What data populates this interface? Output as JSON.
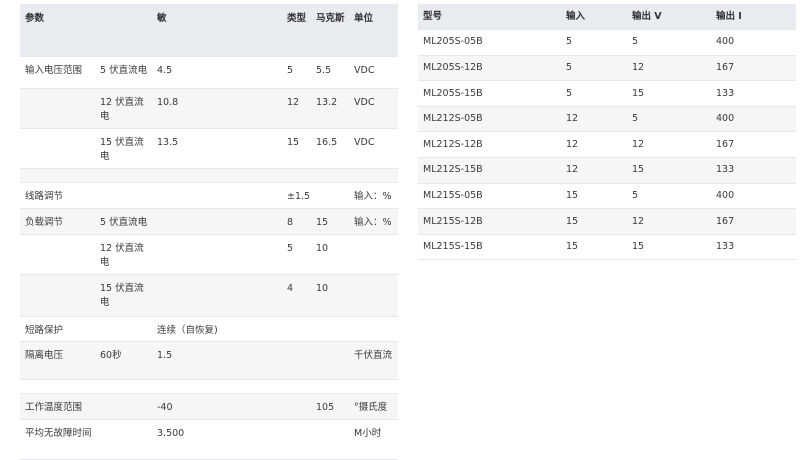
{
  "spec_table": {
    "headers": [
      "参数",
      "",
      "敏",
      "类型",
      "马克斯",
      "单位"
    ],
    "rows": [
      [
        "输入电压范围",
        "5 伏直流电",
        "4.5",
        "5",
        "5.5",
        "VDC"
      ],
      [
        "",
        "12 伏直流电",
        "10.8",
        "12",
        "13.2",
        "VDC"
      ],
      [
        "",
        "15 伏直流电",
        "13.5",
        "15",
        "16.5",
        "VDC"
      ],
      [
        "",
        "",
        "",
        "",
        "",
        ""
      ],
      [
        "线路调节",
        "",
        "",
        "±1.5",
        "",
        "输入：%"
      ],
      [
        "负载调节",
        "5 伏直流电",
        "",
        "8",
        "15",
        "输入：%"
      ],
      [
        "",
        "12 伏直流电",
        "",
        "5",
        "10",
        ""
      ],
      [
        "",
        "15 伏直流电",
        "",
        "4",
        "10",
        ""
      ],
      [
        "短路保护",
        "",
        "连续（自恢复)",
        "",
        "",
        ""
      ],
      [
        "隔离电压",
        "60秒",
        "1.5",
        "",
        "",
        "千伏直流"
      ],
      [
        "",
        "",
        "",
        "",
        "",
        ""
      ],
      [
        "工作温度范围",
        "",
        "-40",
        "",
        "105",
        "°摄氏度"
      ],
      [
        "平均无故障时间",
        "",
        "3.500",
        "",
        "",
        "M小时"
      ]
    ]
  },
  "model_table": {
    "headers": [
      "型号",
      "输入",
      "输出 V",
      "输出 I"
    ],
    "rows": [
      [
        "ML205S-05B",
        "5",
        "5",
        "400"
      ],
      [
        "ML205S-12B",
        "5",
        "12",
        "167"
      ],
      [
        "ML205S-15B",
        "5",
        "15",
        "133"
      ],
      [
        "ML212S-05B",
        "12",
        "5",
        "400"
      ],
      [
        "ML212S-12B",
        "12",
        "12",
        "167"
      ],
      [
        "ML212S-15B",
        "12",
        "15",
        "133"
      ],
      [
        "ML215S-05B",
        "15",
        "5",
        "400"
      ],
      [
        "ML215S-12B",
        "15",
        "12",
        "167"
      ],
      [
        "ML215S-15B",
        "15",
        "15",
        "133"
      ]
    ]
  }
}
